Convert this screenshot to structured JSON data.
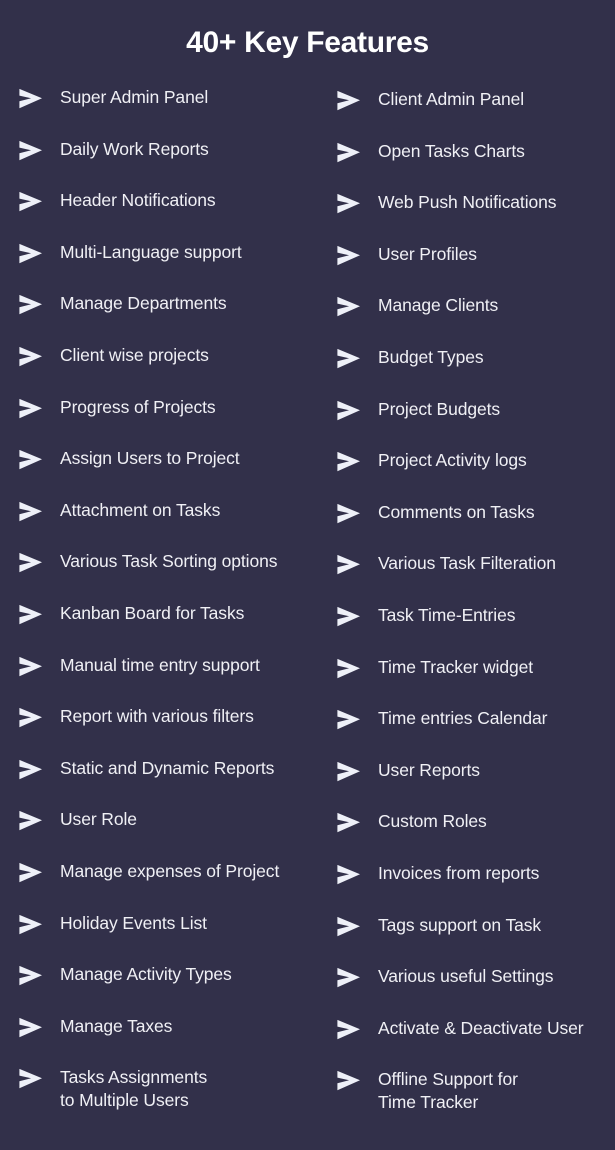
{
  "header": {
    "title": "40+ Key Features"
  },
  "theme": {
    "background": "#32304a",
    "title_color": "#ffffff",
    "text_color": "#f0f0f5",
    "arrow_color": "#eef0f8"
  },
  "icons": {
    "bullet": "arrow-right-icon"
  },
  "features": {
    "left": [
      {
        "label": "Super Admin Panel"
      },
      {
        "label": "Daily Work Reports"
      },
      {
        "label": "Header Notifications"
      },
      {
        "label": "Multi-Language support"
      },
      {
        "label": "Manage Departments"
      },
      {
        "label": "Client wise projects"
      },
      {
        "label": "Progress of Projects"
      },
      {
        "label": "Assign Users to Project"
      },
      {
        "label": "Attachment on Tasks"
      },
      {
        "label": "Various Task Sorting options"
      },
      {
        "label": "Kanban Board for Tasks"
      },
      {
        "label": "Manual time entry support"
      },
      {
        "label": "Report with various filters"
      },
      {
        "label": "Static and Dynamic Reports"
      },
      {
        "label": "User Role"
      },
      {
        "label": "Manage expenses of Project"
      },
      {
        "label": "Holiday Events List"
      },
      {
        "label": "Manage Activity Types"
      },
      {
        "label": "Manage Taxes"
      },
      {
        "label": "Tasks Assignments\nto Multiple Users"
      }
    ],
    "right": [
      {
        "label": "Client Admin Panel"
      },
      {
        "label": "Open Tasks Charts"
      },
      {
        "label": "Web Push Notifications"
      },
      {
        "label": "User Profiles"
      },
      {
        "label": "Manage Clients"
      },
      {
        "label": "Budget Types"
      },
      {
        "label": "Project Budgets"
      },
      {
        "label": "Project Activity logs"
      },
      {
        "label": "Comments on Tasks"
      },
      {
        "label": "Various Task Filteration"
      },
      {
        "label": "Task Time-Entries"
      },
      {
        "label": "Time Tracker widget"
      },
      {
        "label": "Time entries Calendar"
      },
      {
        "label": "User Reports"
      },
      {
        "label": "Custom Roles"
      },
      {
        "label": "Invoices from reports"
      },
      {
        "label": "Tags support on Task"
      },
      {
        "label": "Various useful Settings"
      },
      {
        "label": "Activate & Deactivate User"
      },
      {
        "label": "Offline Support for\nTime Tracker"
      }
    ]
  }
}
